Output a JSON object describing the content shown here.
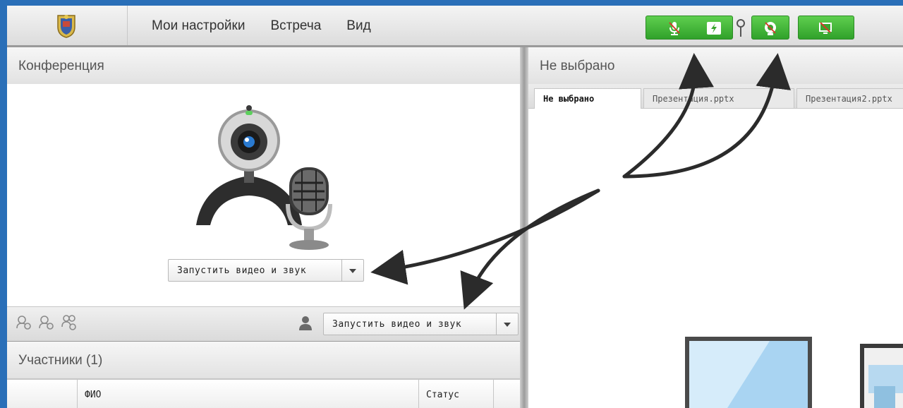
{
  "menubar": {
    "items": [
      "Мои настройки",
      "Встреча",
      "Вид"
    ]
  },
  "toolbar_icons": [
    "microphone-muted-icon",
    "lightning-icon",
    "pin-icon",
    "camera-off-icon",
    "screen-share-off-icon"
  ],
  "conference": {
    "title": "Конференция",
    "start_button_label": "Запустить видео и звук",
    "toolbar_start_label": "Запустить видео и звук"
  },
  "participants": {
    "title": "Участники (1)",
    "columns": [
      "",
      "ФИО",
      "Статус",
      ""
    ]
  },
  "content": {
    "title": "Не выбрано",
    "tabs": [
      "Не выбрано",
      "Презентация.pptx",
      "Презентация2.pptx"
    ]
  },
  "colors": {
    "frame": "#2a6fb8",
    "toolbar_green": "#3cb334",
    "arrow": "#2b2b2b"
  }
}
